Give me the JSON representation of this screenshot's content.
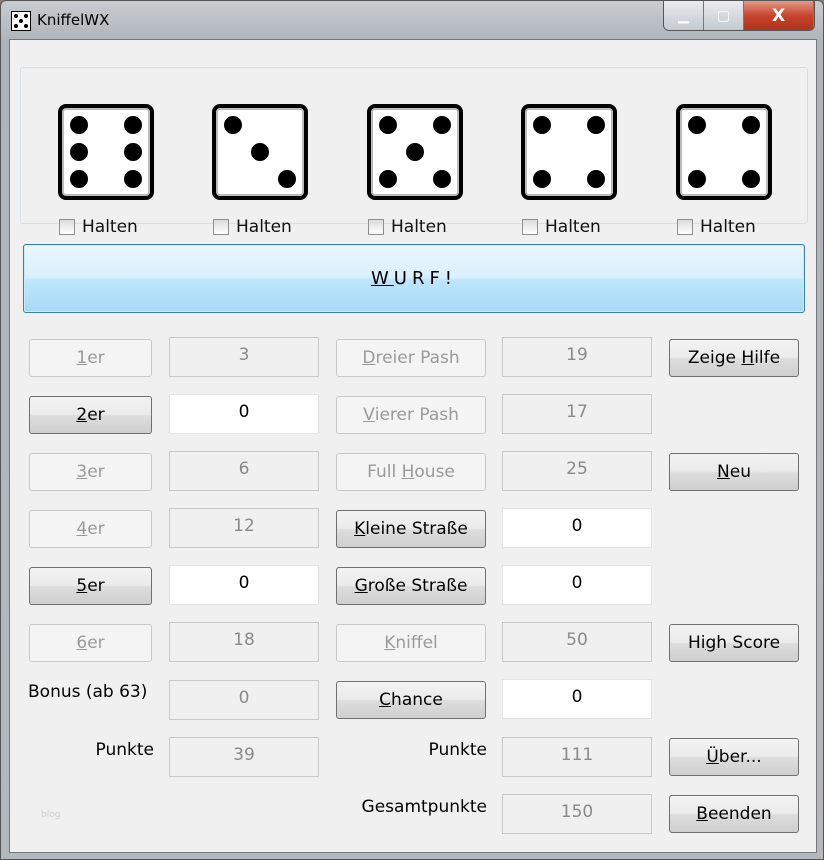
{
  "window": {
    "title": "KniffelWX",
    "minimize": "▁",
    "maximize": "▢",
    "close": "X"
  },
  "dice": [
    {
      "value": 6,
      "hold_label": "Halten",
      "held": false
    },
    {
      "value": 3,
      "hold_label": "Halten",
      "held": false
    },
    {
      "value": 5,
      "hold_label": "Halten",
      "held": false
    },
    {
      "value": 4,
      "hold_label": "Halten",
      "held": false
    },
    {
      "value": 4,
      "hold_label": "Halten",
      "held": false
    }
  ],
  "roll_button": {
    "label_first": "W",
    "label_rest": "URF!"
  },
  "upper": [
    {
      "k": "1",
      "r": "er",
      "value": "3",
      "enabled": false
    },
    {
      "k": "2",
      "r": "er",
      "value": "0",
      "enabled": true
    },
    {
      "k": "3",
      "r": "er",
      "value": "6",
      "enabled": false
    },
    {
      "k": "4",
      "r": "er",
      "value": "12",
      "enabled": false
    },
    {
      "k": "5",
      "r": "er",
      "value": "0",
      "enabled": true
    },
    {
      "k": "6",
      "r": "er",
      "value": "18",
      "enabled": false
    }
  ],
  "lower": [
    {
      "k": "D",
      "r": "reier Pash",
      "pre": "",
      "value": "19",
      "enabled": false
    },
    {
      "k": "V",
      "r": "ierer Pash",
      "pre": "",
      "value": "17",
      "enabled": false
    },
    {
      "k": "H",
      "r": "ouse",
      "pre": "Full ",
      "value": "25",
      "enabled": false
    },
    {
      "k": "K",
      "r": "leine Straße",
      "pre": "",
      "value": "0",
      "enabled": true
    },
    {
      "k": "G",
      "r": "roße Straße",
      "pre": "",
      "value": "0",
      "enabled": true
    },
    {
      "k": "K",
      "r": "niffel",
      "pre": "",
      "value": "50",
      "enabled": false
    },
    {
      "k": "C",
      "r": "hance",
      "pre": "",
      "value": "0",
      "enabled": true
    }
  ],
  "bonus": {
    "label": "Bonus (ab 63)",
    "value": "0"
  },
  "upper_total": {
    "label": "Punkte",
    "value": "39"
  },
  "lower_total": {
    "label": "Punkte",
    "value": "111"
  },
  "grand_total": {
    "label": "Gesamtpunkte",
    "value": "150"
  },
  "side": [
    {
      "pre": "Zeige ",
      "k": "H",
      "r": "ilfe"
    },
    {
      "pre": "",
      "k": "N",
      "r": "eu"
    },
    {
      "pre": "Hi",
      "k": "g",
      "r": "h Score"
    },
    {
      "pre": "",
      "k": "Ü",
      "r": "ber..."
    },
    {
      "pre": "",
      "k": "B",
      "r": "eenden"
    }
  ],
  "watermark": "blog"
}
